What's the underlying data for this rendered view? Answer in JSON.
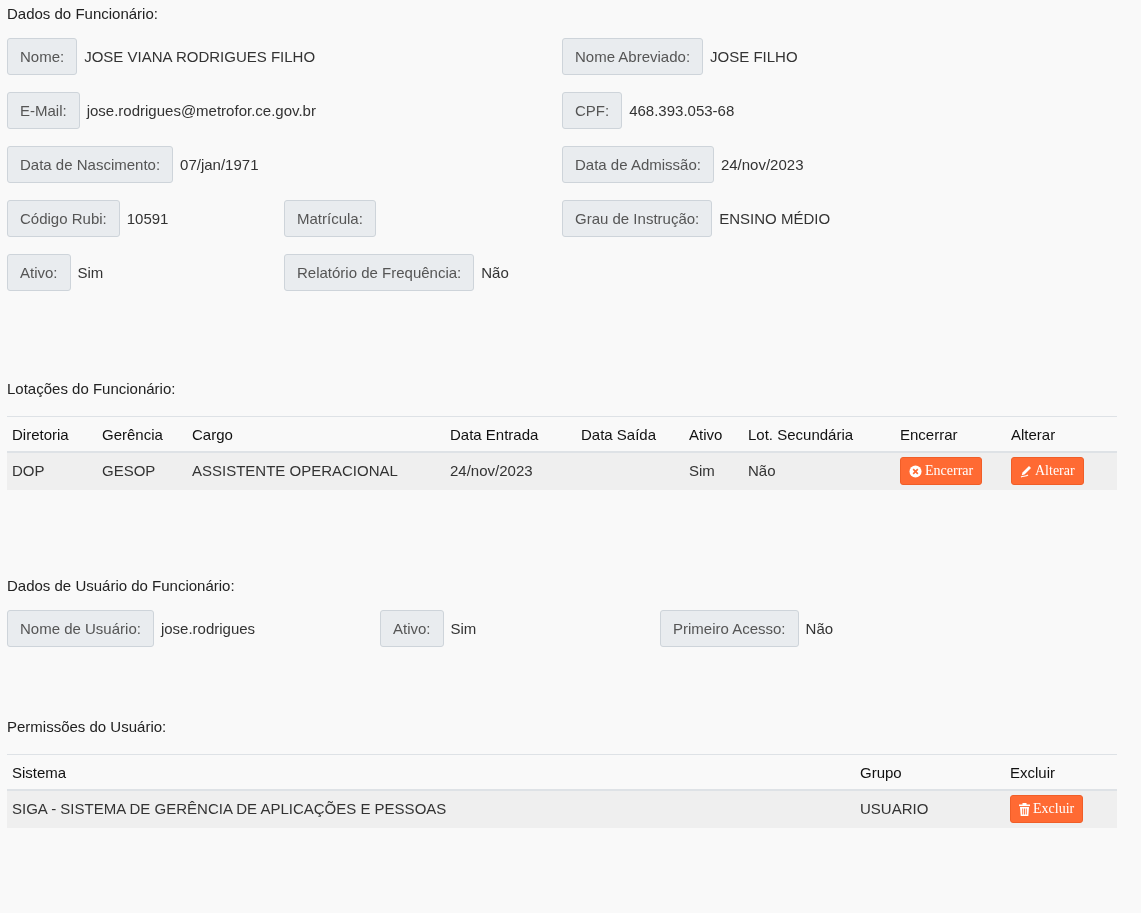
{
  "employee": {
    "title": "Dados do Funcionário:",
    "rows": [
      [
        {
          "label": "Nome:",
          "value": "JOSE VIANA RODRIGUES FILHO"
        },
        null,
        {
          "label": "Nome Abreviado:",
          "value": "JOSE FILHO"
        }
      ],
      [
        {
          "label": "E-Mail:",
          "value": "jose.rodrigues@metrofor.ce.gov.br"
        },
        null,
        {
          "label": "CPF:",
          "value": "468.393.053-68"
        }
      ],
      [
        {
          "label": "Data de Nascimento:",
          "value": "07/jan/1971"
        },
        null,
        {
          "label": "Data de Admissão:",
          "value": "24/nov/2023"
        }
      ],
      [
        {
          "label": "Código Rubi:",
          "value": "10591"
        },
        {
          "label": "Matrícula:"
        },
        {
          "label": "Grau de Instrução:",
          "value": "ENSINO MÉDIO"
        }
      ],
      [
        {
          "label": "Ativo:",
          "value": "Sim"
        },
        {
          "label": "Relatório de Frequência:",
          "value": "Não"
        },
        null
      ]
    ]
  },
  "assignments": {
    "title": "Lotações do Funcionário:",
    "columns": [
      "Diretoria",
      "Gerência",
      "Cargo",
      "Data Entrada",
      "Data Saída",
      "Ativo",
      "Lot. Secundária",
      "Encerrar",
      "Alterar"
    ],
    "rows": [
      {
        "cells": [
          "DOP",
          "GESOP",
          "ASSISTENTE OPERACIONAL",
          "24/nov/2023",
          null,
          "Sim",
          "Não"
        ],
        "actions": [
          {
            "kind": "close",
            "label": "Encerrar"
          },
          {
            "kind": "edit",
            "label": "Alterar"
          }
        ]
      }
    ]
  },
  "user": {
    "title": "Dados de Usuário do Funcionário:",
    "fields": [
      {
        "label": "Nome de Usuário:",
        "value": "jose.rodrigues"
      },
      {
        "label": "Ativo:",
        "value": "Sim"
      },
      {
        "label": "Primeiro Acesso:",
        "value": "Não"
      }
    ]
  },
  "permissions": {
    "title": "Permissões do Usuário:",
    "columns": [
      "Sistema",
      "Grupo",
      "Excluir"
    ],
    "rows": [
      {
        "cells": [
          "SIGA - SISTEMA DE GERÊNCIA DE APLICAÇÕES E PESSOAS",
          "USUARIO"
        ],
        "actions": [
          {
            "kind": "delete",
            "label": "Excluir"
          }
        ]
      }
    ]
  }
}
